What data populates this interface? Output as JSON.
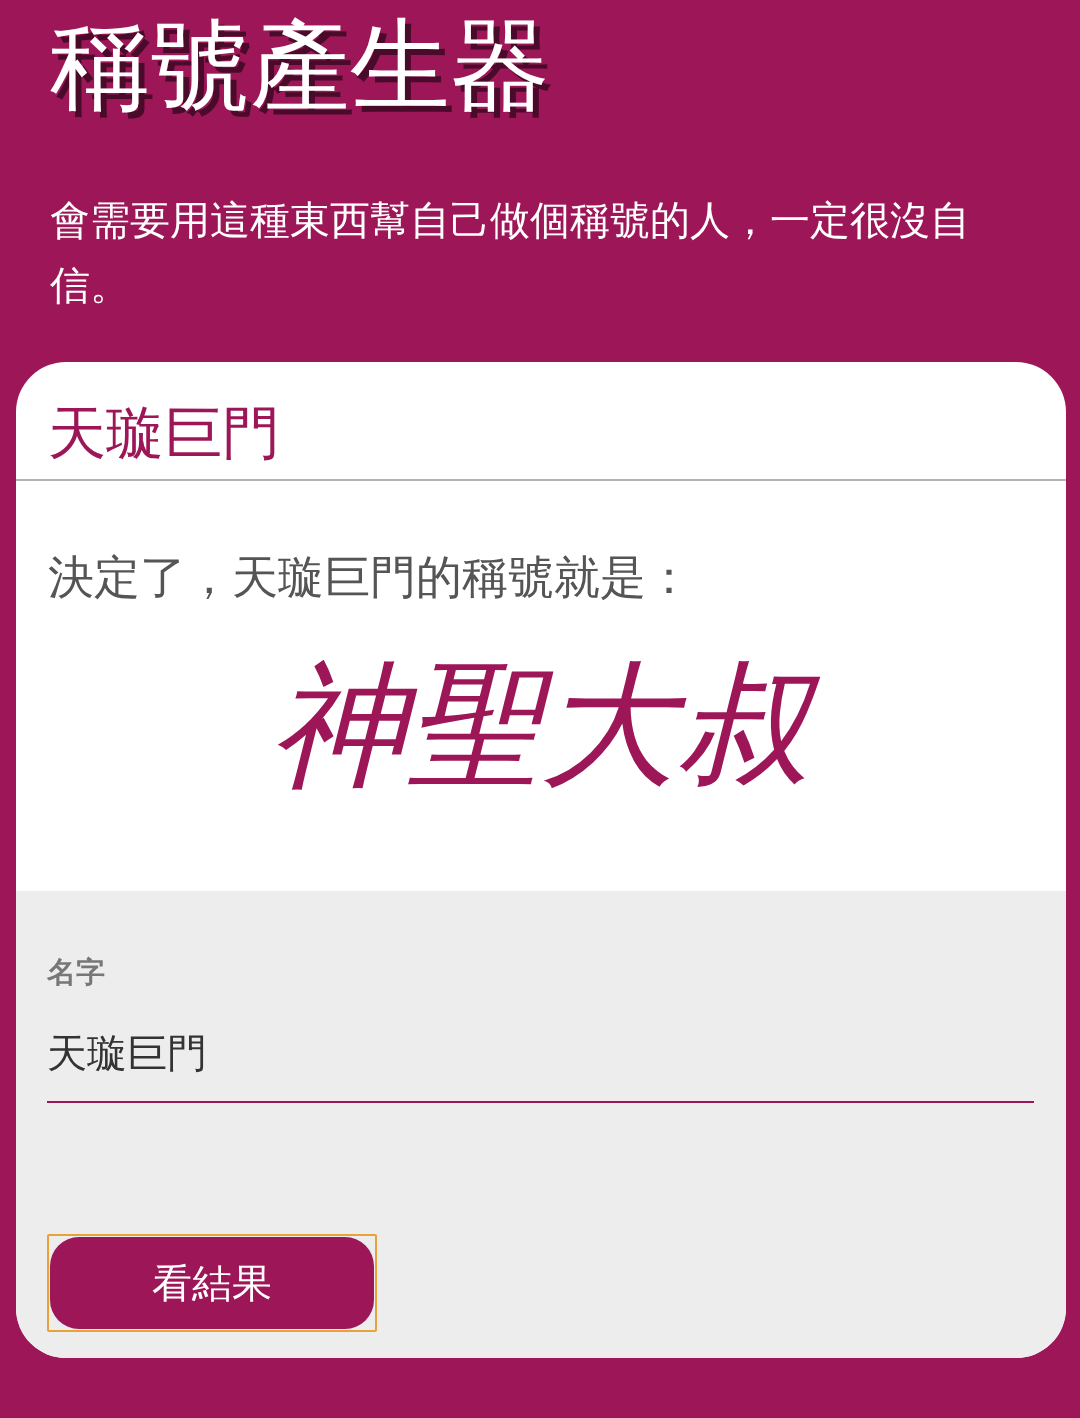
{
  "header": {
    "title": "稱號產生器",
    "description": "會需要用這種東西幫自己做個稱號的人，一定很沒自信。"
  },
  "card": {
    "title": "天璇巨門",
    "result_intro": "決定了，天璇巨門的稱號就是：",
    "result": "神聖大叔",
    "form": {
      "label": "名字",
      "value": "天璇巨門"
    },
    "button": {
      "label": "看結果",
      "focused": true
    }
  }
}
